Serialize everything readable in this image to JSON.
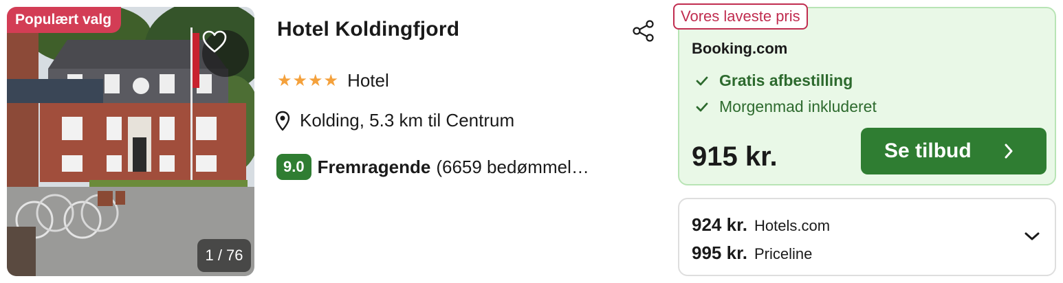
{
  "hotel": {
    "name": "Hotel Koldingfjord",
    "badge": "Populært valg",
    "photo_counter": "1 / 76",
    "stars": "★★★★",
    "type": "Hotel",
    "location": "Kolding, 5.3 km til Centrum",
    "rating_score": "9.0",
    "rating_word": "Fremragende",
    "rating_count": "(6659 bedømmel…"
  },
  "deal": {
    "badge": "Vores laveste pris",
    "provider": "Booking.com",
    "perks": [
      "Gratis afbestilling",
      "Morgenmad inkluderet"
    ],
    "price": "915 kr.",
    "cta_label": "Se tilbud"
  },
  "other_offers": [
    {
      "price": "924 kr.",
      "provider": "Hotels.com"
    },
    {
      "price": "995 kr.",
      "provider": "Priceline"
    }
  ],
  "colors": {
    "popular_badge": "#d33d55",
    "lowest_badge": "#c02c4f",
    "deal_background": "#e9f8e7",
    "cta": "#2f7d32",
    "stars": "#f4a13c"
  }
}
